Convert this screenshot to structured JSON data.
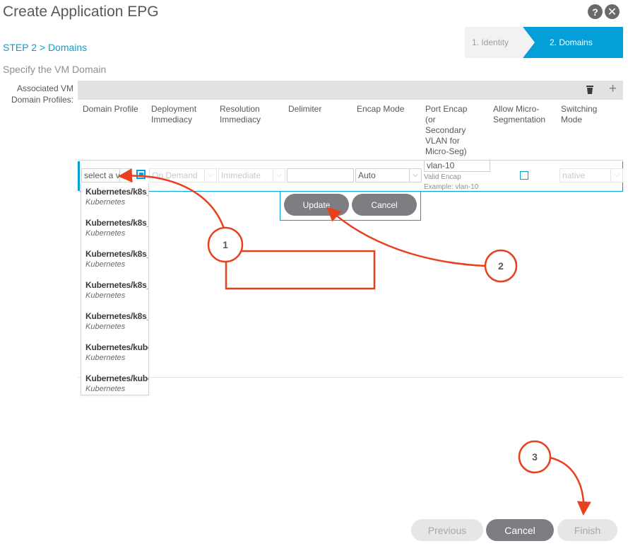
{
  "dialog": {
    "title": "Create Application EPG",
    "help_icon": "question-icon",
    "close_icon": "close-icon"
  },
  "wizard": {
    "step_label": "STEP 2 > Domains",
    "steps": [
      {
        "label": "1. Identity",
        "active": false
      },
      {
        "label": "2. Domains",
        "active": true
      }
    ]
  },
  "section": {
    "subtitle": "Specify the VM Domain",
    "field_label": "Associated VM Domain Profiles:"
  },
  "table": {
    "headers": {
      "domain_profile": "Domain Profile",
      "deployment_immediacy": "Deployment Immediacy",
      "resolution_immediacy": "Resolution Immediacy",
      "delimiter": "Delimiter",
      "encap_mode": "Encap Mode",
      "port_encap": "Port Encap (or Secondary VLAN for Micro-Seg)",
      "allow_micro_seg": "Allow Micro-Segmentation",
      "switching_mode": "Switching Mode"
    },
    "edit_row": {
      "domain_profile_placeholder": "select a v",
      "deployment_immediacy": "On Demand",
      "resolution_immediacy": "Immediate",
      "delimiter": "",
      "encap_mode": "Auto",
      "port_encap": "vlan-10",
      "port_encap_hint_1": "Valid Encap",
      "port_encap_hint_2": "Example: vlan-10",
      "allow_micro_seg": false,
      "switching_mode": "native"
    },
    "row_actions": {
      "update": "Update",
      "cancel": "Cancel"
    }
  },
  "dropdown": {
    "options": [
      {
        "name": "Kubernetes/k8s_",
        "type": "Kubernetes"
      },
      {
        "name": "Kubernetes/k8s_",
        "type": "Kubernetes"
      },
      {
        "name": "Kubernetes/k8s_",
        "type": "Kubernetes"
      },
      {
        "name": "Kubernetes/k8s_",
        "type": "Kubernetes"
      },
      {
        "name": "Kubernetes/k8s_",
        "type": "Kubernetes"
      },
      {
        "name": "Kubernetes/kube",
        "type": "Kubernetes"
      },
      {
        "name": "Kubernetes/kube",
        "type": "Kubernetes"
      }
    ]
  },
  "footer": {
    "previous": "Previous",
    "cancel": "Cancel",
    "finish": "Finish"
  },
  "callouts": {
    "markers": [
      "1",
      "2",
      "3"
    ],
    "color": "#e8401c"
  },
  "colors": {
    "accent": "#049fd9",
    "button_gray": "#7e7e82",
    "disabled_button": "#e6e6e8"
  }
}
